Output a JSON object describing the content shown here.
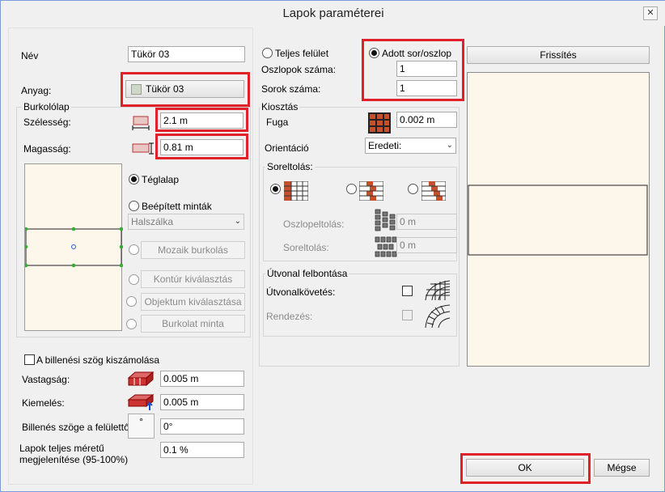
{
  "window": {
    "title": "Lapok paraméterei",
    "close_glyph": "✕"
  },
  "left": {
    "name_label": "Név",
    "name_value": "Tükör 03",
    "material_label": "Anyag:",
    "material_button": "Tükör 03",
    "material_color": "#cfd8c8",
    "tile_group": "Burkolólap",
    "width_label": "Szélesség:",
    "width_value": "2.1 m",
    "height_label": "Magasság:",
    "height_value": "0.81 m",
    "shape_options": {
      "rect": "Téglalap",
      "builtin": "Beépített minták",
      "builtin_select": "Halszálka",
      "mosaic": "Mozaik burkolás",
      "contour": "Kontúr kiválasztás",
      "object": "Objektum kiválasztása",
      "pattern": "Burkolat minta"
    },
    "tilt_checkbox": "A billenési szög kiszámolása",
    "thickness_label": "Vastagság:",
    "thickness_value": "0.005 m",
    "raise_label": "Kiemelés:",
    "raise_value": "0.005 m",
    "tilt_angle_label": "Billenés szöge a felülettől",
    "tilt_angle_glyph": "°",
    "tilt_angle_value": "0°",
    "fullsize_label_1": "Lapok teljes méretű",
    "fullsize_label_2": "megjelenítése (95-100%)",
    "fullsize_value": "0.1 %"
  },
  "middle": {
    "full_surface": "Teljes felület",
    "given_rows_cols": "Adott sor/oszlop",
    "columns_label": "Oszlopok száma:",
    "columns_value": "1",
    "rows_label": "Sorok száma:",
    "rows_value": "1",
    "layout_group": "Kiosztás",
    "joint_label": "Fuga",
    "joint_value": "0.002 m",
    "orientation_label": "Orientáció",
    "orientation_value": "Eredeti:",
    "row_shift_group": "Soreltolás:",
    "col_offset_label": "Oszlopeltolás:",
    "col_offset_value": "0 m",
    "row_offset_label": "Soreltolás:",
    "row_offset_value": "0 m",
    "path_group": "Útvonal felbontása",
    "path_follow_label": "Útvonalkövetés:",
    "arrange_label": "Rendezés:"
  },
  "right": {
    "refresh_button": "Frissítés",
    "preview_bg": "#fdf6ea"
  },
  "footer": {
    "ok_button": "OK",
    "cancel_button": "Mégse"
  },
  "colors": {
    "highlight": "#e1212a",
    "brick": "#c4502c"
  }
}
